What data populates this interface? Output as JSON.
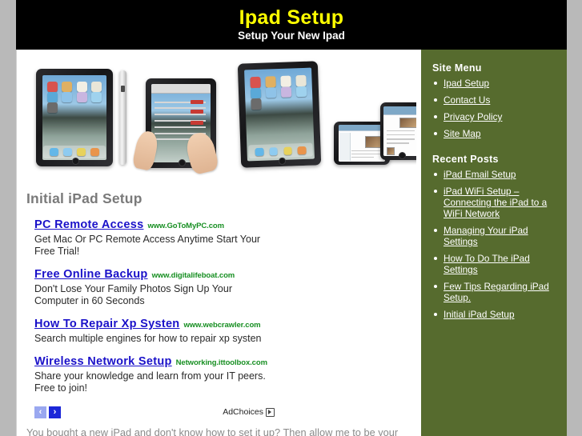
{
  "header": {
    "title": "Ipad Setup",
    "subtitle": "Setup Your New Ipad"
  },
  "main": {
    "post_title": "Initial iPad Setup",
    "body_text": "You bought a new iPad and don't know how to set it up? Then allow me to be your",
    "ads": [
      {
        "title": "PC Remote Access",
        "url": "www.GoToMyPC.com",
        "desc": "Get Mac Or PC Remote Access Anytime Start Your Free Trial!"
      },
      {
        "title": "Free Online Backup",
        "url": "www.digitalifeboat.com",
        "desc": "Don't Lose Your Family Photos Sign Up Your Computer in 60 Seconds"
      },
      {
        "title": "How To Repair Xp Systen",
        "url": "www.webcrawler.com",
        "desc": "Search multiple engines for how to repair xp systen"
      },
      {
        "title": "Wireless Network Setup",
        "url": "Networking.ittoolbox.com",
        "desc": "Share your knowledge and learn from your IT peers. Free to join!"
      }
    ],
    "ad_footer": {
      "prev_label": "‹",
      "next_label": "›",
      "adchoices_label": "AdChoices"
    }
  },
  "sidebar": {
    "site_menu_heading": "Site Menu",
    "site_menu": [
      {
        "label": "Ipad Setup"
      },
      {
        "label": "Contact Us"
      },
      {
        "label": "Privacy Policy"
      },
      {
        "label": "Site Map"
      }
    ],
    "recent_posts_heading": "Recent Posts",
    "recent_posts": [
      {
        "label": "iPad Email Setup"
      },
      {
        "label": "iPad WiFi Setup – Connecting the iPad to a WiFi Network"
      },
      {
        "label": "Managing Your iPad Settings"
      },
      {
        "label": "How To Do The iPad Settings"
      },
      {
        "label": "Few Tips Regarding iPad Setup."
      },
      {
        "label": "Initial iPad Setup"
      }
    ]
  },
  "colors": {
    "header_bg": "#000000",
    "header_title": "#ffff00",
    "sidebar_bg": "#566b2e",
    "page_bg": "#b9b9b9",
    "ad_link": "#1a11c9",
    "ad_url": "#178f22"
  }
}
